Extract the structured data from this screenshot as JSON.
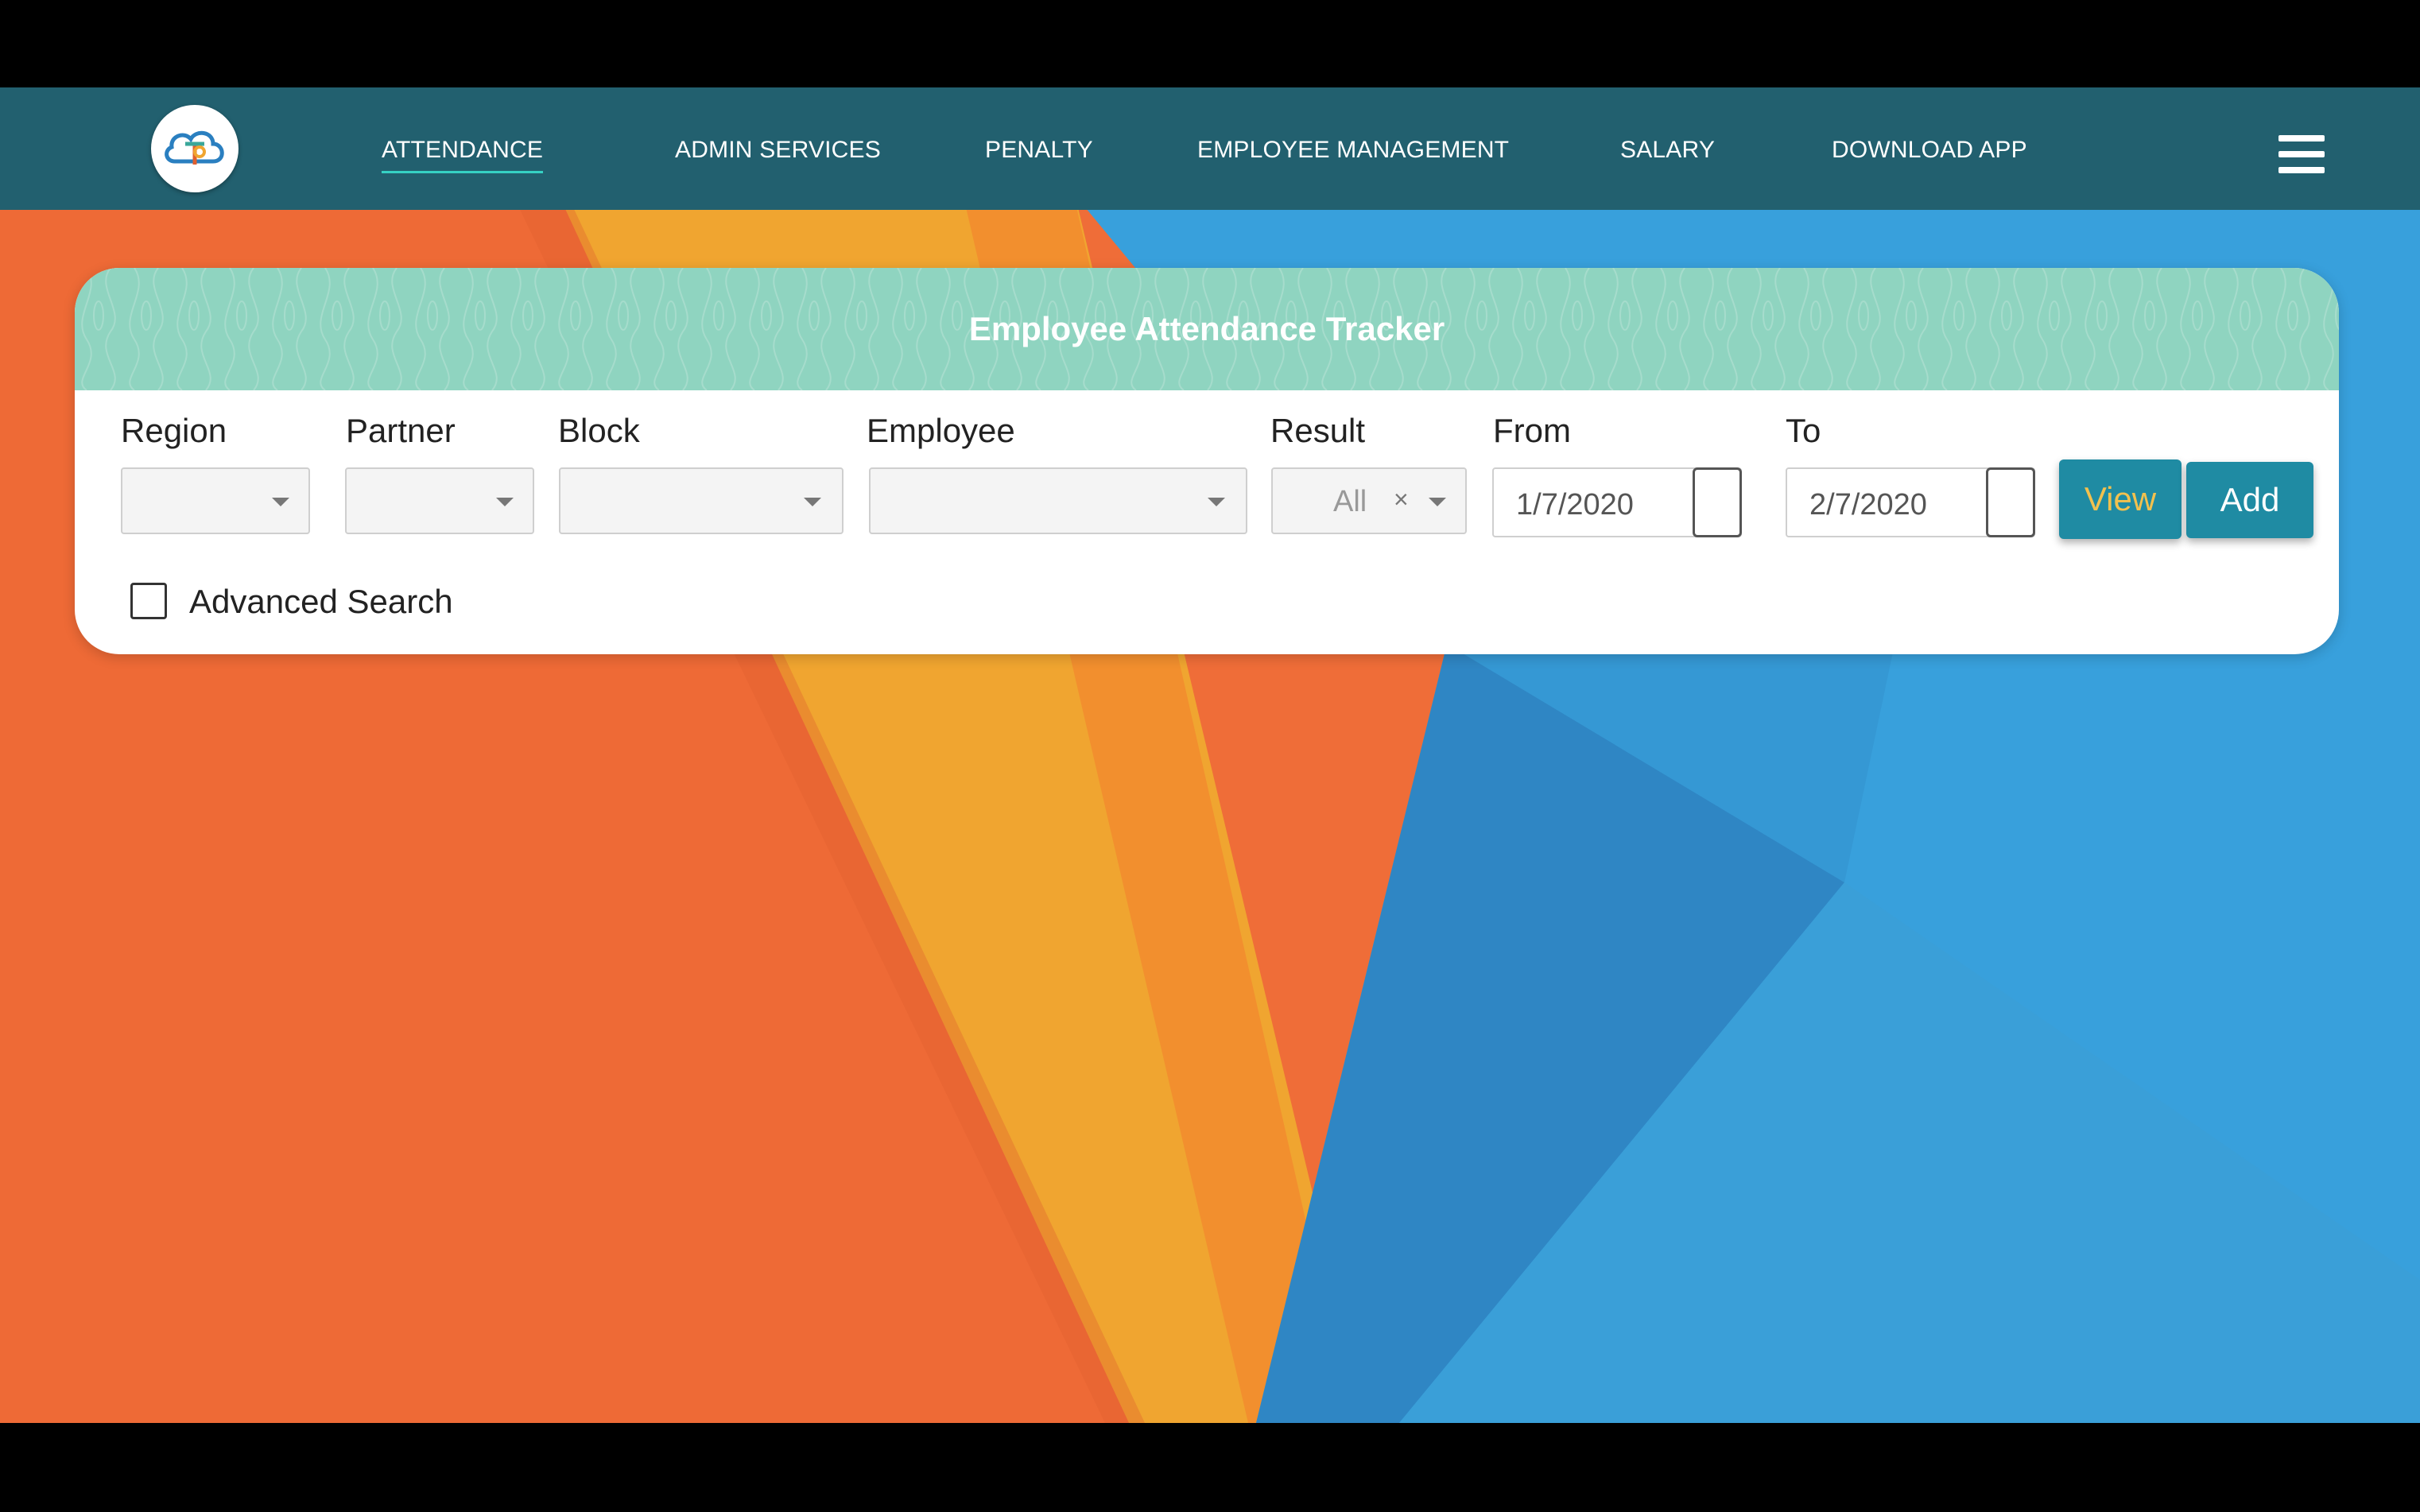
{
  "nav": {
    "items": [
      {
        "label": "ATTENDANCE",
        "active": true
      },
      {
        "label": "ADMIN SERVICES"
      },
      {
        "label": "PENALTY"
      },
      {
        "label": "EMPLOYEE MANAGEMENT"
      },
      {
        "label": "SALARY"
      },
      {
        "label": "DOWNLOAD APP"
      }
    ],
    "menu_icon": "hamburger-icon",
    "logo_icon": "cloud-logo"
  },
  "panel": {
    "title": "Employee Attendance Tracker"
  },
  "filters": {
    "region": {
      "label": "Region",
      "value": ""
    },
    "partner": {
      "label": "Partner",
      "value": ""
    },
    "block": {
      "label": "Block",
      "value": ""
    },
    "employee": {
      "label": "Employee",
      "value": ""
    },
    "result": {
      "label": "Result",
      "value": "All",
      "clear": "×"
    },
    "from": {
      "label": "From",
      "value": "1/7/2020"
    },
    "to": {
      "label": "To",
      "value": "2/7/2020"
    }
  },
  "actions": {
    "view_label": "View",
    "add_label": "Add"
  },
  "advanced_search": {
    "label": "Advanced Search",
    "checked": false
  },
  "colors": {
    "navbar": "#22606f",
    "panel_header": "#8fd4c0",
    "button": "#1f8ba3",
    "view_text": "#f2c14e",
    "bg_orange": "#ef6d38",
    "bg_yellow": "#f0a530",
    "bg_blue": "#38a0dc"
  }
}
